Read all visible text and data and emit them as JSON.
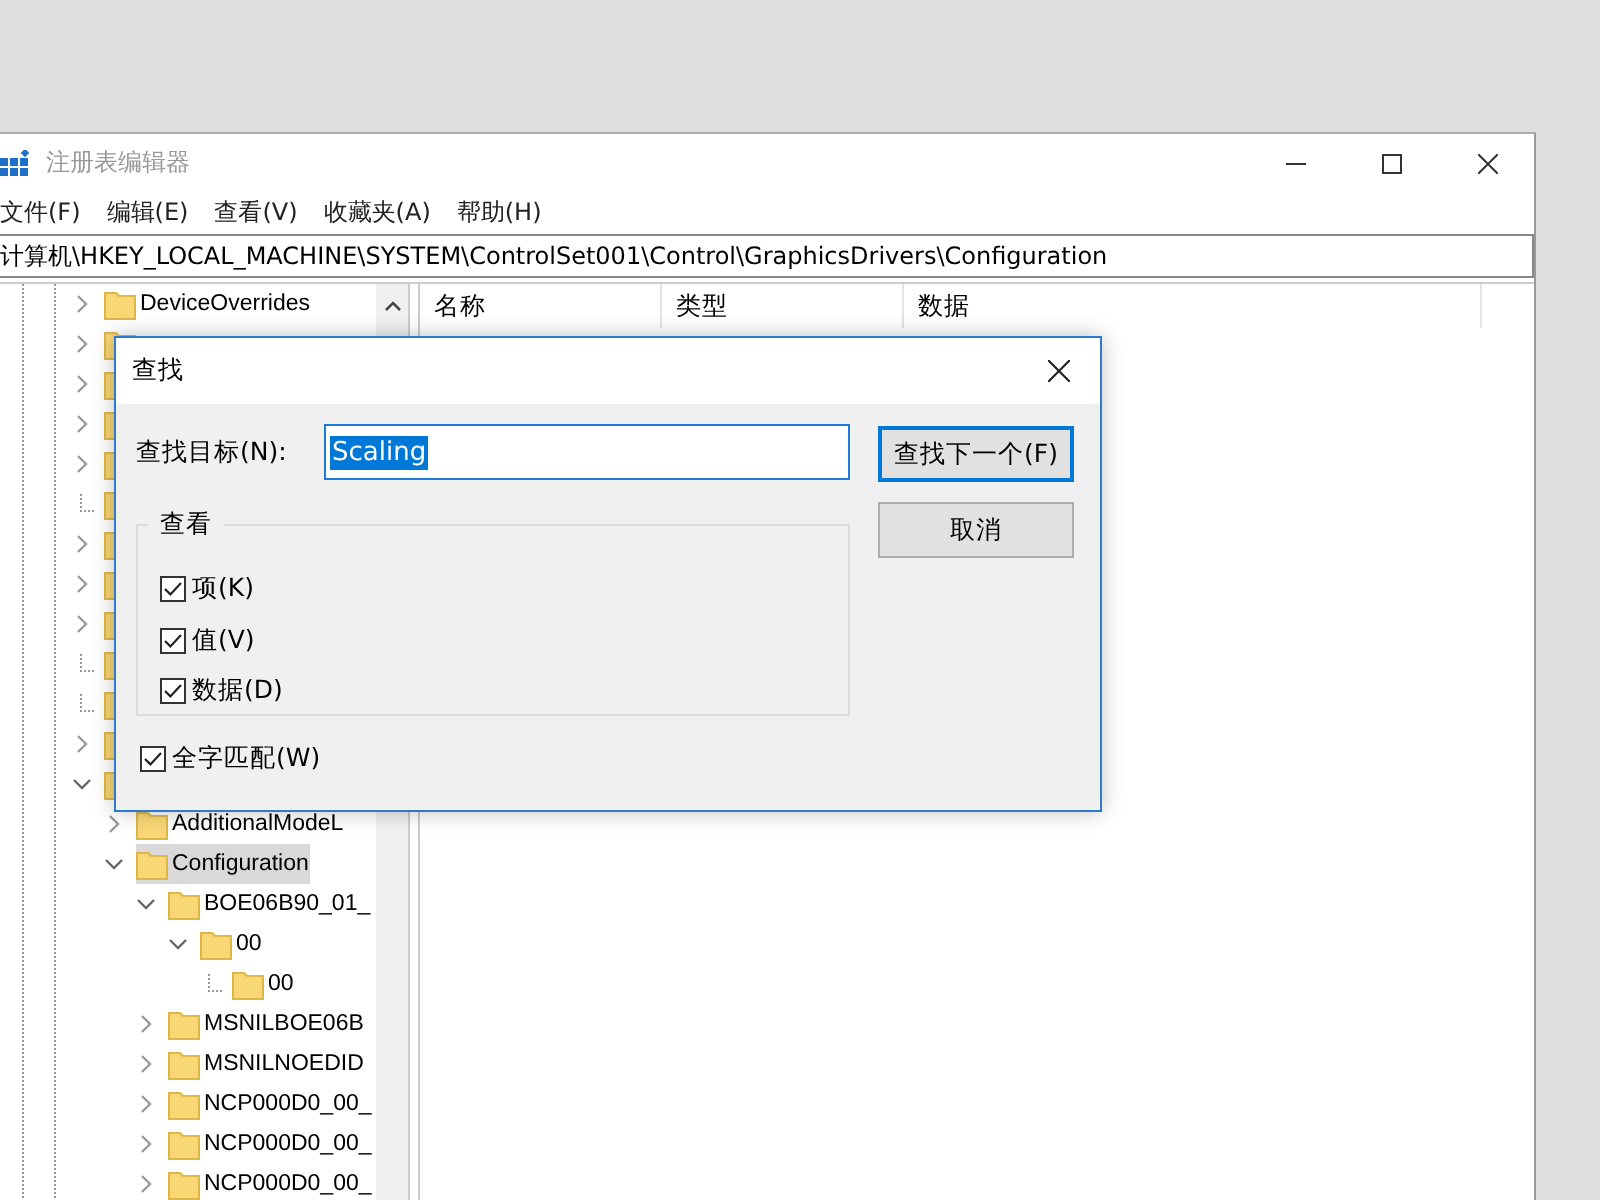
{
  "window": {
    "title": "注册表编辑器"
  },
  "menu": [
    "文件(F)",
    "编辑(E)",
    "查看(V)",
    "收藏夹(A)",
    "帮助(H)"
  ],
  "address": "计算机\\HKEY_LOCAL_MACHINE\\SYSTEM\\ControlSet001\\Control\\GraphicsDrivers\\Configuration",
  "tree": {
    "items": [
      {
        "kind": "folder",
        "label": "DeviceOverrides",
        "expandable": true,
        "expanded": false,
        "selected": false
      },
      {
        "kind": "covered",
        "expandable": true,
        "expanded": false
      },
      {
        "kind": "covered",
        "expandable": true,
        "expanded": false
      },
      {
        "kind": "covered",
        "expandable": true,
        "expanded": false
      },
      {
        "kind": "covered",
        "expandable": true,
        "expanded": false
      },
      {
        "kind": "covered",
        "expandable": false
      },
      {
        "kind": "covered",
        "expandable": true,
        "expanded": false
      },
      {
        "kind": "covered",
        "expandable": true,
        "expanded": false
      },
      {
        "kind": "covered",
        "expandable": true,
        "expanded": false
      },
      {
        "kind": "covered",
        "expandable": false
      },
      {
        "kind": "covered",
        "expandable": false
      },
      {
        "kind": "covered",
        "expandable": true,
        "expanded": false
      },
      {
        "kind": "covered",
        "expandable": true,
        "expanded": true,
        "children": [
          {
            "kind": "folder",
            "label": "AdditionalModeL",
            "expandable": true,
            "expanded": false,
            "selected": false
          },
          {
            "kind": "folder",
            "label": "Configuration",
            "expandable": true,
            "expanded": true,
            "selected": true,
            "children": [
              {
                "kind": "folder",
                "label": "BOE06B90_01_",
                "expandable": true,
                "expanded": true,
                "selected": false,
                "children": [
                  {
                    "kind": "folder",
                    "label": "00",
                    "expandable": true,
                    "expanded": true,
                    "selected": false,
                    "children": [
                      {
                        "kind": "folder",
                        "label": "00",
                        "expandable": false,
                        "selected": false
                      }
                    ]
                  }
                ]
              },
              {
                "kind": "folder",
                "label": "MSNILBOE06B",
                "expandable": true,
                "expanded": false,
                "selected": false
              },
              {
                "kind": "folder",
                "label": "MSNILNOEDID",
                "expandable": true,
                "expanded": false,
                "selected": false
              },
              {
                "kind": "folder",
                "label": "NCP000D0_00_",
                "expandable": true,
                "expanded": false,
                "selected": false
              },
              {
                "kind": "folder",
                "label": "NCP000D0_00_",
                "expandable": true,
                "expanded": false,
                "selected": false
              },
              {
                "kind": "folder",
                "label": "NCP000D0_00_",
                "expandable": true,
                "expanded": false,
                "selected": false
              }
            ]
          }
        ]
      }
    ]
  },
  "list": {
    "columns": [
      "名称",
      "类型",
      "数据"
    ]
  },
  "dialog": {
    "title": "查找",
    "find_label": "查找目标(N):",
    "find_value": "Scaling",
    "value_selected": true,
    "buttons": [
      {
        "label": "查找下一个(F)",
        "focused": true
      },
      {
        "label": "取消",
        "focused": false
      }
    ],
    "group": {
      "title": "查看",
      "options": [
        {
          "label": "项(K)",
          "checked": true
        },
        {
          "label": "值(V)",
          "checked": true
        },
        {
          "label": "数据(D)",
          "checked": true
        }
      ]
    },
    "whole_word": {
      "label": "全字匹配(W)",
      "checked": true
    }
  }
}
